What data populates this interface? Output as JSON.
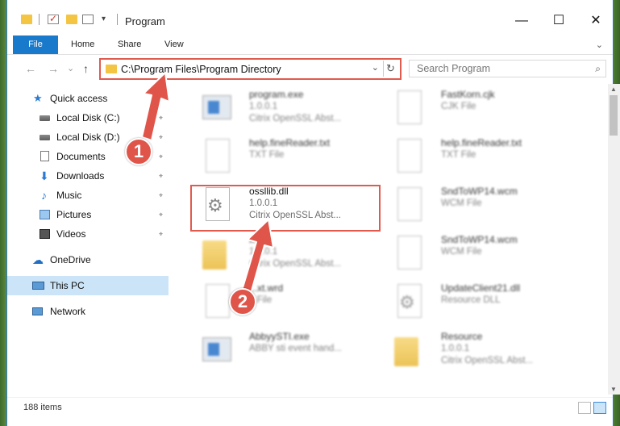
{
  "window": {
    "title": "Program",
    "minimize": "—",
    "maximize": "☐",
    "close": "✕"
  },
  "ribbon": {
    "tabs": [
      "File",
      "Home",
      "Share",
      "View"
    ],
    "expand": "⌄"
  },
  "nav": {
    "back": "←",
    "forward": "→",
    "recent": "⌄",
    "up": "↑",
    "address": "C:\\Program Files\\Program Directory",
    "address_dropdown": "⌄",
    "refresh": "↻",
    "search_placeholder": "Search Program",
    "search_glyph": "⌕"
  },
  "sidebar": {
    "items": [
      {
        "label": "Quick access",
        "icon": "star-icon",
        "glyph": "★",
        "pinned": false
      },
      {
        "label": "Local Disk (C:)",
        "icon": "drive-icon",
        "glyph": "",
        "pinned": true
      },
      {
        "label": "Local Disk (D:)",
        "icon": "drive-icon",
        "glyph": "",
        "pinned": true
      },
      {
        "label": "Documents",
        "icon": "document-icon",
        "glyph": "",
        "pinned": true
      },
      {
        "label": "Downloads",
        "icon": "download-icon",
        "glyph": "⬇",
        "pinned": true
      },
      {
        "label": "Music",
        "icon": "music-icon",
        "glyph": "♪",
        "pinned": true
      },
      {
        "label": "Pictures",
        "icon": "pictures-icon",
        "glyph": "",
        "pinned": true
      },
      {
        "label": "Videos",
        "icon": "videos-icon",
        "glyph": "",
        "pinned": true
      },
      {
        "label": "OneDrive",
        "icon": "cloud-icon",
        "glyph": "☁",
        "pinned": false
      },
      {
        "label": "This PC",
        "icon": "computer-icon",
        "glyph": "",
        "pinned": false,
        "selected": true
      },
      {
        "label": "Network",
        "icon": "network-icon",
        "glyph": "",
        "pinned": false
      }
    ],
    "pin_glyph": "⌖"
  },
  "files": [
    {
      "name": "program.exe",
      "line1": "1.0.0.1",
      "line2": "Citrix OpenSSL Abst...",
      "icon": "application-icon"
    },
    {
      "name": "FastKorn.cjk",
      "line1": "CJK File",
      "line2": "",
      "icon": "file-icon"
    },
    {
      "name": "help.fineReader.txt",
      "line1": "TXT File",
      "line2": "",
      "icon": "file-icon"
    },
    {
      "name": "help.fineReader.txt",
      "line1": "TXT File",
      "line2": "",
      "icon": "file-icon"
    },
    {
      "name": "ossllib.dll",
      "line1": "1.0.0.1",
      "line2": "Citrix OpenSSL Abst...",
      "icon": "dll-gear-icon",
      "highlighted": true
    },
    {
      "name": "SndToWP14.wcm",
      "line1": "WCM File",
      "line2": "",
      "icon": "file-icon"
    },
    {
      "name": "x64",
      "line1": "1.0.0.1",
      "line2": "Citrix OpenSSL Abst...",
      "icon": "folder-icon"
    },
    {
      "name": "SndToWP14.wcm",
      "line1": "WCM File",
      "line2": "",
      "icon": "file-icon"
    },
    {
      "name": "...xt.wrd",
      "line1": "...File",
      "line2": "",
      "icon": "file-icon"
    },
    {
      "name": "UpdateClient21.dll",
      "line1": "Resource DLL",
      "line2": "",
      "icon": "dll-gear-icon"
    },
    {
      "name": "AbbyySTI.exe",
      "line1": "ABBY sti event hand...",
      "line2": "",
      "icon": "application-icon"
    },
    {
      "name": "Resource",
      "line1": "1.0.0.1",
      "line2": "Citrix OpenSSL Abst...",
      "icon": "folder-icon"
    }
  ],
  "gear_glyph": "⚙",
  "status": {
    "count": "188 items"
  },
  "annotations": {
    "step1": "1",
    "step2": "2",
    "color": "#e0554a"
  },
  "scroll": {
    "up": "▲",
    "down": "▼"
  }
}
